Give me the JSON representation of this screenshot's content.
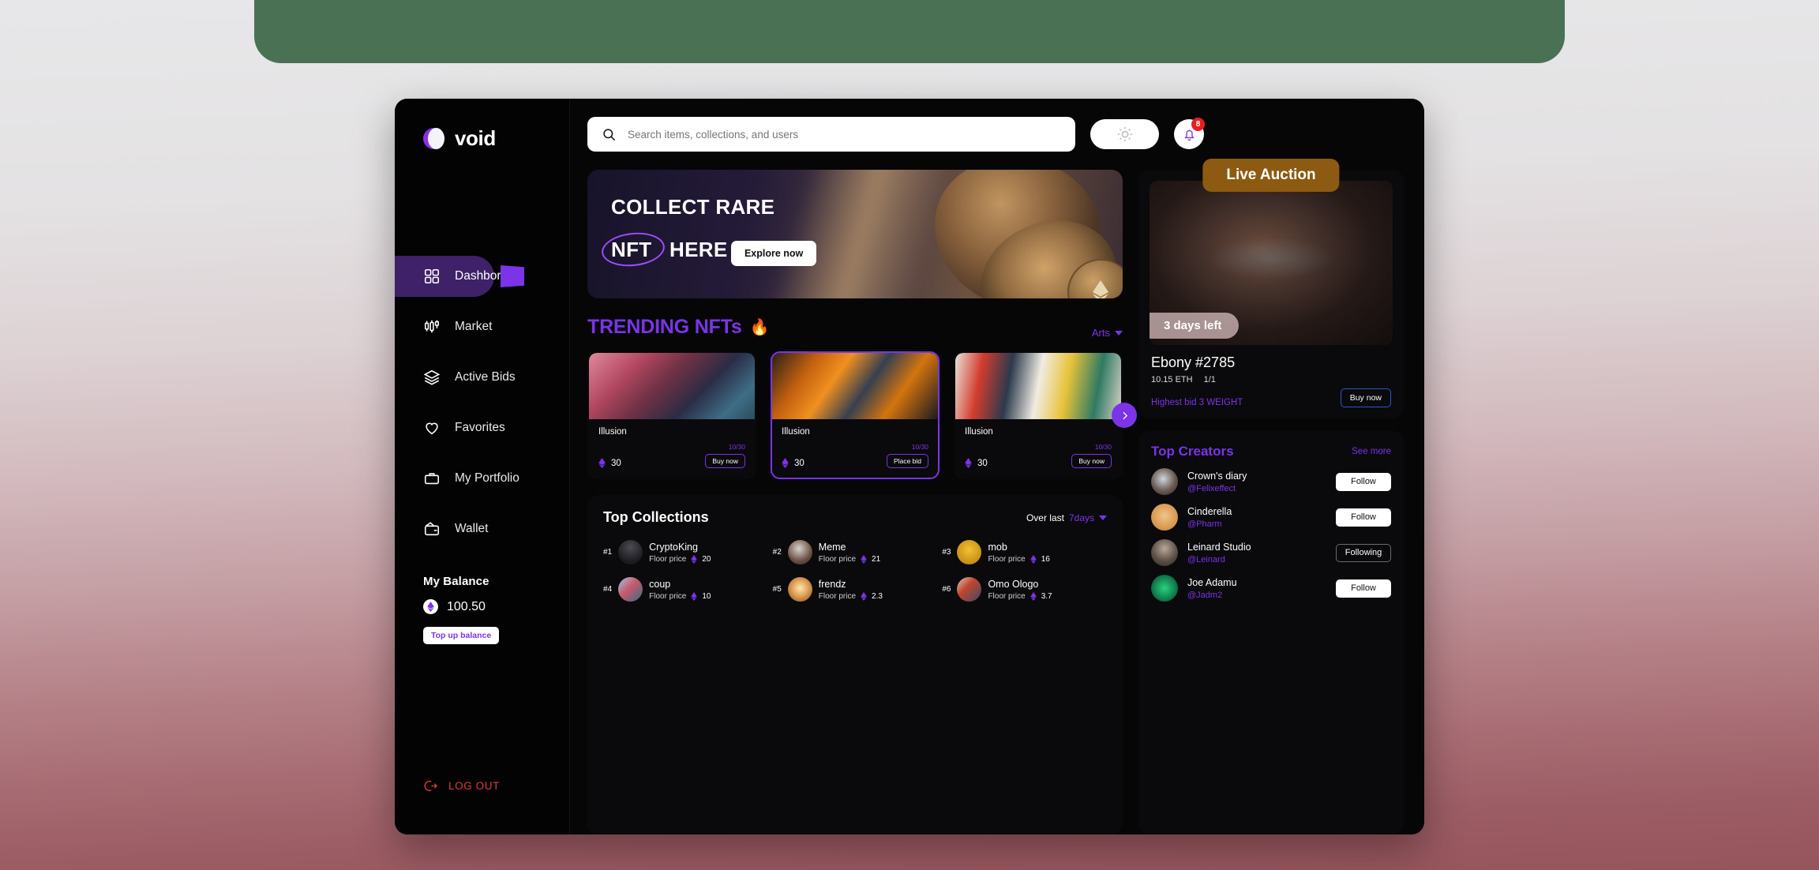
{
  "brand": {
    "name": "void"
  },
  "sidebar": {
    "items": [
      {
        "label": "Dashbord",
        "icon": "grid-icon",
        "active": true
      },
      {
        "label": "Market",
        "icon": "candlestick-icon",
        "active": false
      },
      {
        "label": "Active Bids",
        "icon": "layers-icon",
        "active": false
      },
      {
        "label": "Favorites",
        "icon": "heart-icon",
        "active": false
      },
      {
        "label": "My Portfolio",
        "icon": "briefcase-icon",
        "active": false
      },
      {
        "label": "Wallet",
        "icon": "wallet-icon",
        "active": false
      }
    ],
    "balance": {
      "title": "My Balance",
      "amount": "100.50",
      "topup_label": "Top up balance"
    },
    "logout_label": "LOG OUT"
  },
  "topbar": {
    "search_placeholder": "Search items, collections, and users",
    "search_value": "",
    "notification_count": "8"
  },
  "hero": {
    "line1": "COLLECT RARE",
    "line2_highlight": "NFT",
    "line2_rest": "HERE",
    "cta": "Explore now"
  },
  "trending": {
    "title": "TRENDING NFTs",
    "emoji": "🔥",
    "filter": "Arts",
    "cards": [
      {
        "name": "Illusion",
        "price": "30",
        "count": "10/30",
        "action": "Buy now",
        "selected": false
      },
      {
        "name": "Illusion",
        "price": "30",
        "count": "10/30",
        "action": "Place bid",
        "selected": true
      },
      {
        "name": "Illusion",
        "price": "30",
        "count": "10/30",
        "action": "Buy now",
        "selected": false
      }
    ]
  },
  "collections": {
    "title": "Top Collections",
    "filter_prefix": "Over last",
    "filter_value": "7days",
    "floor_label": "Floor price",
    "items": [
      {
        "rank": "#1",
        "name": "CryptoKing",
        "floor": "20"
      },
      {
        "rank": "#2",
        "name": "Meme",
        "floor": "21"
      },
      {
        "rank": "#3",
        "name": "mob",
        "floor": "16"
      },
      {
        "rank": "#4",
        "name": "coup",
        "floor": "10"
      },
      {
        "rank": "#5",
        "name": "frendz",
        "floor": "2.3"
      },
      {
        "rank": "#6",
        "name": "Omo Ologo",
        "floor": "3.7"
      }
    ]
  },
  "auction": {
    "badge": "Live Auction",
    "time_left": "3 days left",
    "title": "Ebony #2785",
    "price": "10.15 ETH",
    "edition": "1/1",
    "highest_bid": "Highest bid 3 WEIGHT",
    "cta": "Buy now"
  },
  "creators": {
    "title": "Top Creators",
    "see_more": "See more",
    "items": [
      {
        "name": "Crown's diary",
        "handle": "@Felixeffect",
        "action": "Follow",
        "following": false
      },
      {
        "name": "Cinderella",
        "handle": "@Pharm",
        "action": "Follow",
        "following": false
      },
      {
        "name": "Leinard Studio",
        "handle": "@Leinard",
        "action": "Following",
        "following": true
      },
      {
        "name": "Joe Adamu",
        "handle": "@Jadm2",
        "action": "Follow",
        "following": false
      }
    ]
  },
  "colors": {
    "accent": "#7b34e8",
    "danger": "#e03b3b",
    "auction_badge": "#8c5a10"
  }
}
